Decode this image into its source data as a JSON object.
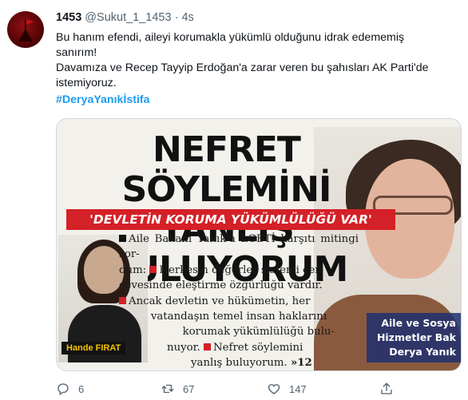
{
  "tweet": {
    "display_name": "1453",
    "handle": "@Sukut_1_1453",
    "separator": "·",
    "time": "4s",
    "lines": [
      "Bu hanım efendi, aileyi korumakla yükümlü olduğunu idrak edememiş",
      "sanırım!",
      "Davamıza ve Recep Tayyip Erdoğan'a zarar veren bu şahısları AK Parti'de",
      "istemiyoruz."
    ],
    "hashtag": "#DeryaYanıkİstifa"
  },
  "media": {
    "headline_1": "NEFRET SÖYLEMİNİ",
    "headline_2": "YANLIŞ BULUYORUM",
    "banner": "'DEVLETİN KORUMA YÜKÜMLÜLÜĞÜ VAR'",
    "byline_name": "Hande FIRAT",
    "article": [
      "Aile Bakanı Yanık'a LGBTİ karşıtı mitingi sor-",
      "dum:",
      "Herkesin değerler sistemi çer-",
      "çevesinde eleştirme özgürlüğü vardır.",
      "Ancak devletin ve hükümetin, her",
      "vatandaşın temel insan haklarını",
      "korumak yükümlülüğü bulu-",
      "nuyor.",
      "Nefret söylemini",
      "yanlış buluyorum.",
      "»12"
    ],
    "caption_1": "Aile ve Sosya",
    "caption_2": "Hizmetler Bak",
    "caption_3": "Derya Yanık"
  },
  "actions": {
    "reply_count": "6",
    "retweet_count": "67",
    "like_count": "147",
    "share_label": ""
  },
  "colors": {
    "accent": "#1d9bf0",
    "muted": "#536471",
    "banner_red": "#d42027"
  },
  "icons": {
    "reply": "reply-icon",
    "retweet": "retweet-icon",
    "like": "heart-icon",
    "share": "share-icon"
  }
}
